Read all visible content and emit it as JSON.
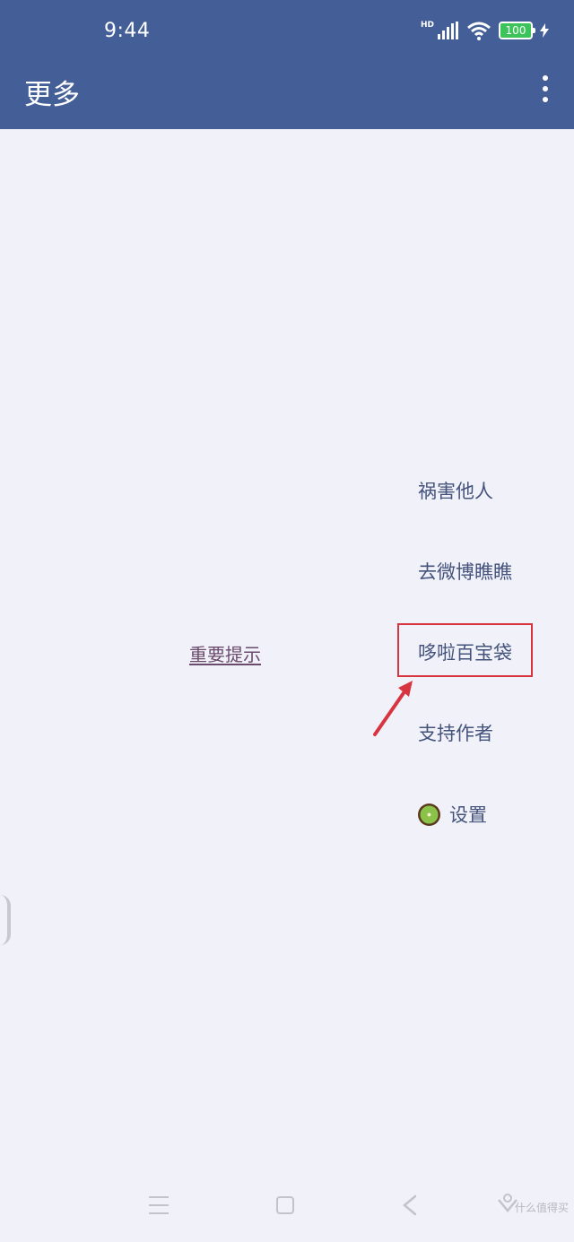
{
  "status_bar": {
    "time": "9:44",
    "network_label": "HD",
    "battery": "100",
    "icons": [
      "signal-icon",
      "wifi-icon",
      "battery-icon",
      "charging-icon"
    ]
  },
  "app_bar": {
    "title": "更多",
    "overflow_icon": "more-vert-icon"
  },
  "menu": {
    "items": [
      {
        "label": "祸害他人"
      },
      {
        "label": "去微博瞧瞧"
      },
      {
        "label": "哆啦百宝袋"
      },
      {
        "label": "支持作者"
      },
      {
        "label": "设置",
        "icon": "kiwi-icon"
      }
    ]
  },
  "important_notice": "重要提示",
  "navigation_bar": {
    "icons": [
      "menu-icon",
      "home-icon",
      "back-icon",
      "assistant-icon"
    ]
  },
  "watermark": "什么值得买",
  "colors": {
    "app_bar": "#445f97",
    "background": "#f1f2f9",
    "menu_text": "#44527c",
    "link_text": "#6b4a6d",
    "highlight": "#d7343f"
  }
}
